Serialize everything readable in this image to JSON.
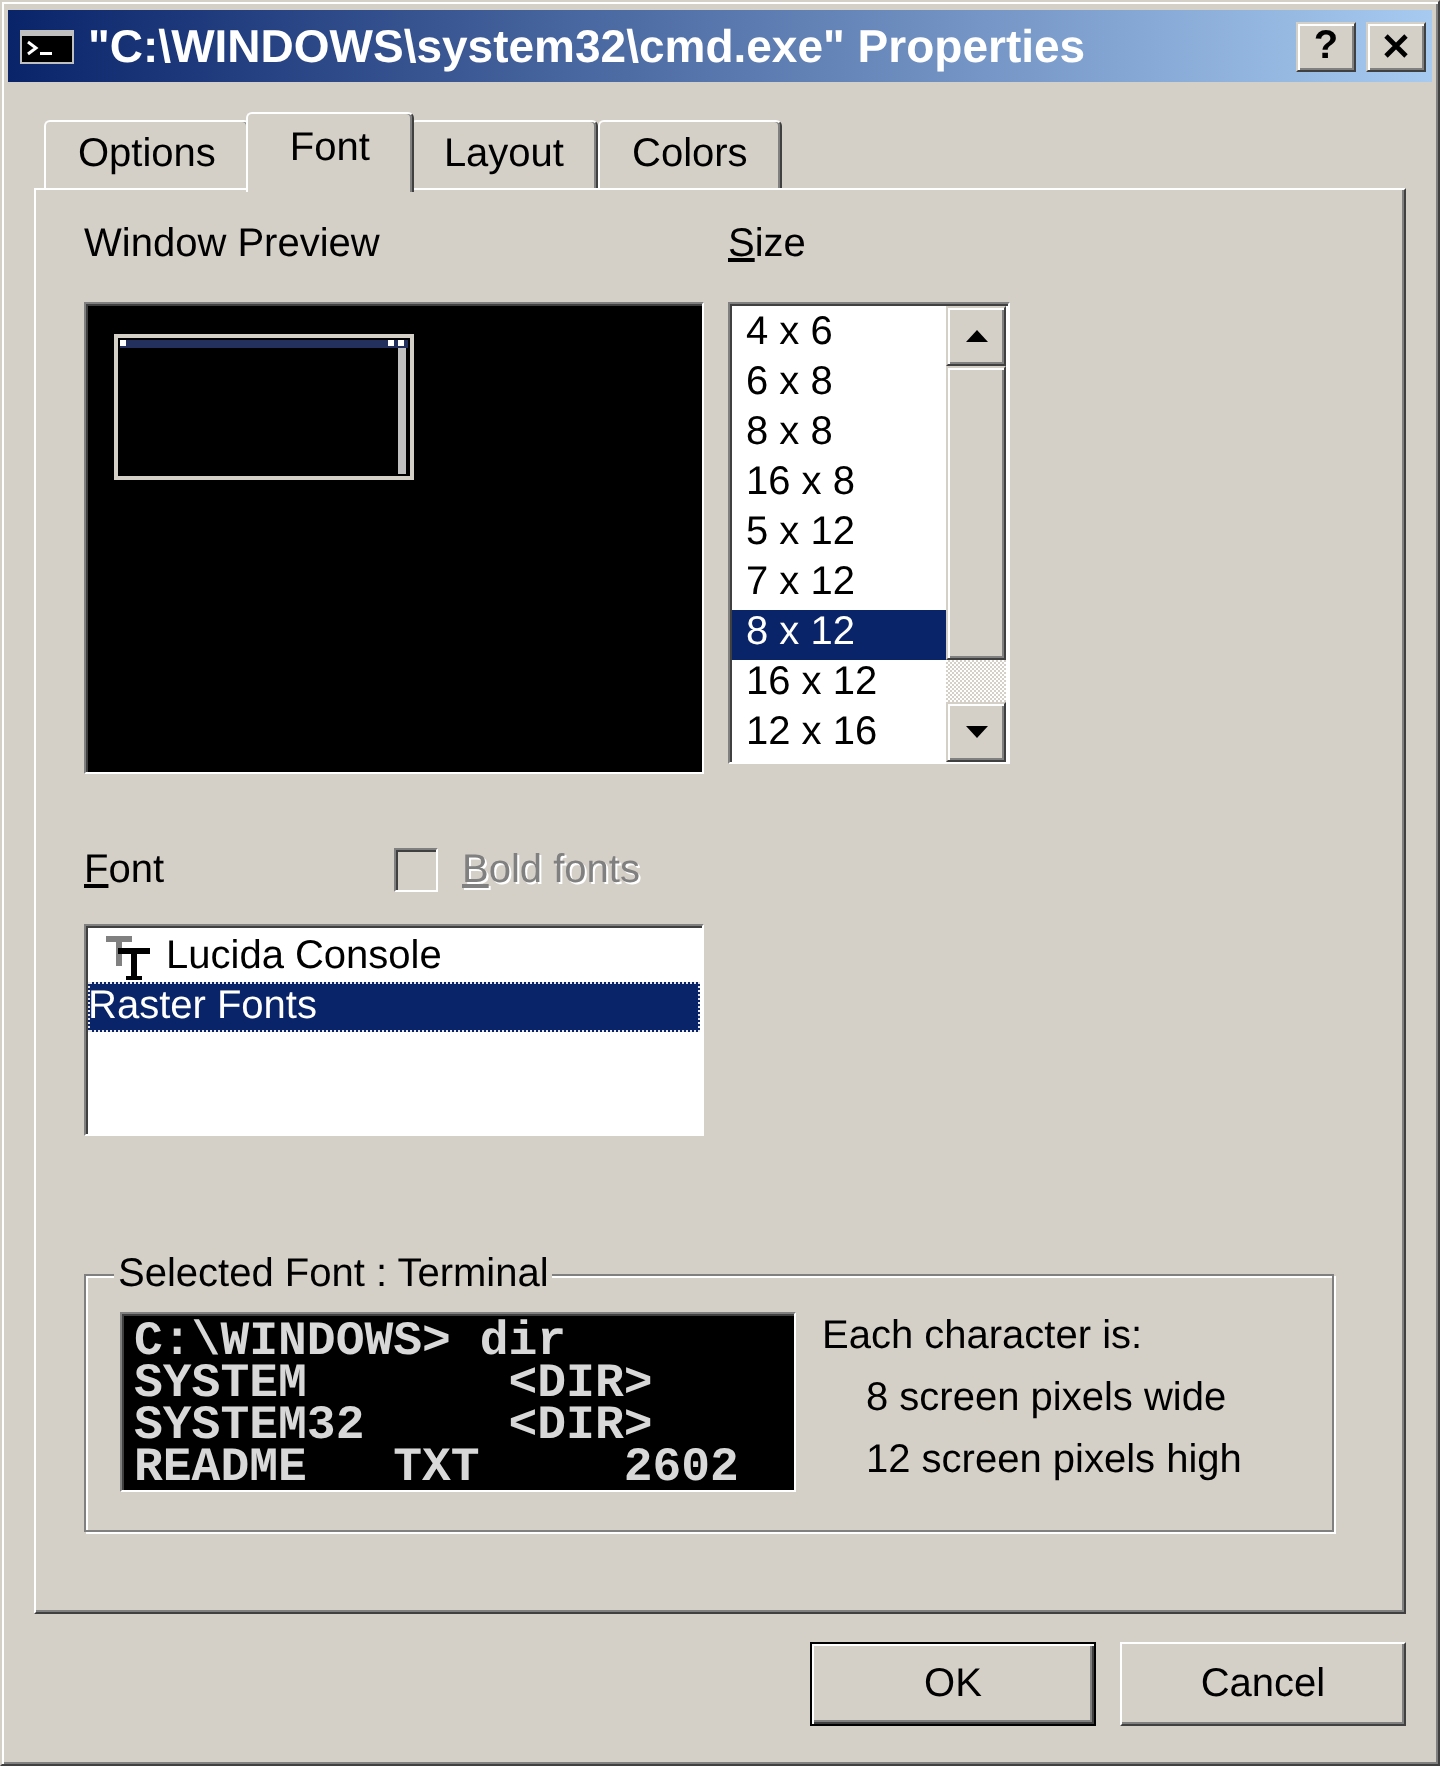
{
  "window": {
    "title": "\"C:\\WINDOWS\\system32\\cmd.exe\" Properties",
    "controls": [
      {
        "kind": "help",
        "label": "?"
      },
      {
        "kind": "close"
      }
    ]
  },
  "tabs": [
    {
      "label": "Options",
      "selected": false
    },
    {
      "label": "Font",
      "selected": true
    },
    {
      "label": "Layout",
      "selected": false
    },
    {
      "label": "Colors",
      "selected": false
    }
  ],
  "window_preview": {
    "label": "Window Preview"
  },
  "size": {
    "label": "Size",
    "underline_first_letter": true,
    "items": [
      {
        "label": "4 x 6",
        "selected": false
      },
      {
        "label": "6 x 8",
        "selected": false
      },
      {
        "label": "8 x 8",
        "selected": false
      },
      {
        "label": "16 x 8",
        "selected": false
      },
      {
        "label": "5 x 12",
        "selected": false
      },
      {
        "label": "7 x 12",
        "selected": false
      },
      {
        "label": "8 x 12",
        "selected": true
      },
      {
        "label": "16 x 12",
        "selected": false
      },
      {
        "label": "12 x 16",
        "selected": false
      }
    ]
  },
  "font": {
    "label": "Font",
    "underline_first_letter": true,
    "bold_fonts": {
      "label": "Bold fonts",
      "underline_first_letter": true,
      "checked": false,
      "disabled": true
    },
    "focused": true,
    "items": [
      {
        "label": "Lucida Console",
        "kind": "truetype",
        "selected": false
      },
      {
        "label": "Raster Fonts",
        "kind": "raster",
        "selected": true
      }
    ]
  },
  "selected_font": {
    "legend": "Selected Font : Terminal",
    "sample_lines": [
      "C:\\WINDOWS> dir",
      "SYSTEM       <DIR>",
      "SYSTEM32     <DIR>",
      "README   TXT     2602"
    ],
    "details": [
      "Each character is:",
      "8 screen pixels wide",
      "12 screen pixels high"
    ]
  },
  "buttons": [
    {
      "label": "OK",
      "default": true
    },
    {
      "label": "Cancel",
      "default": false
    }
  ]
}
